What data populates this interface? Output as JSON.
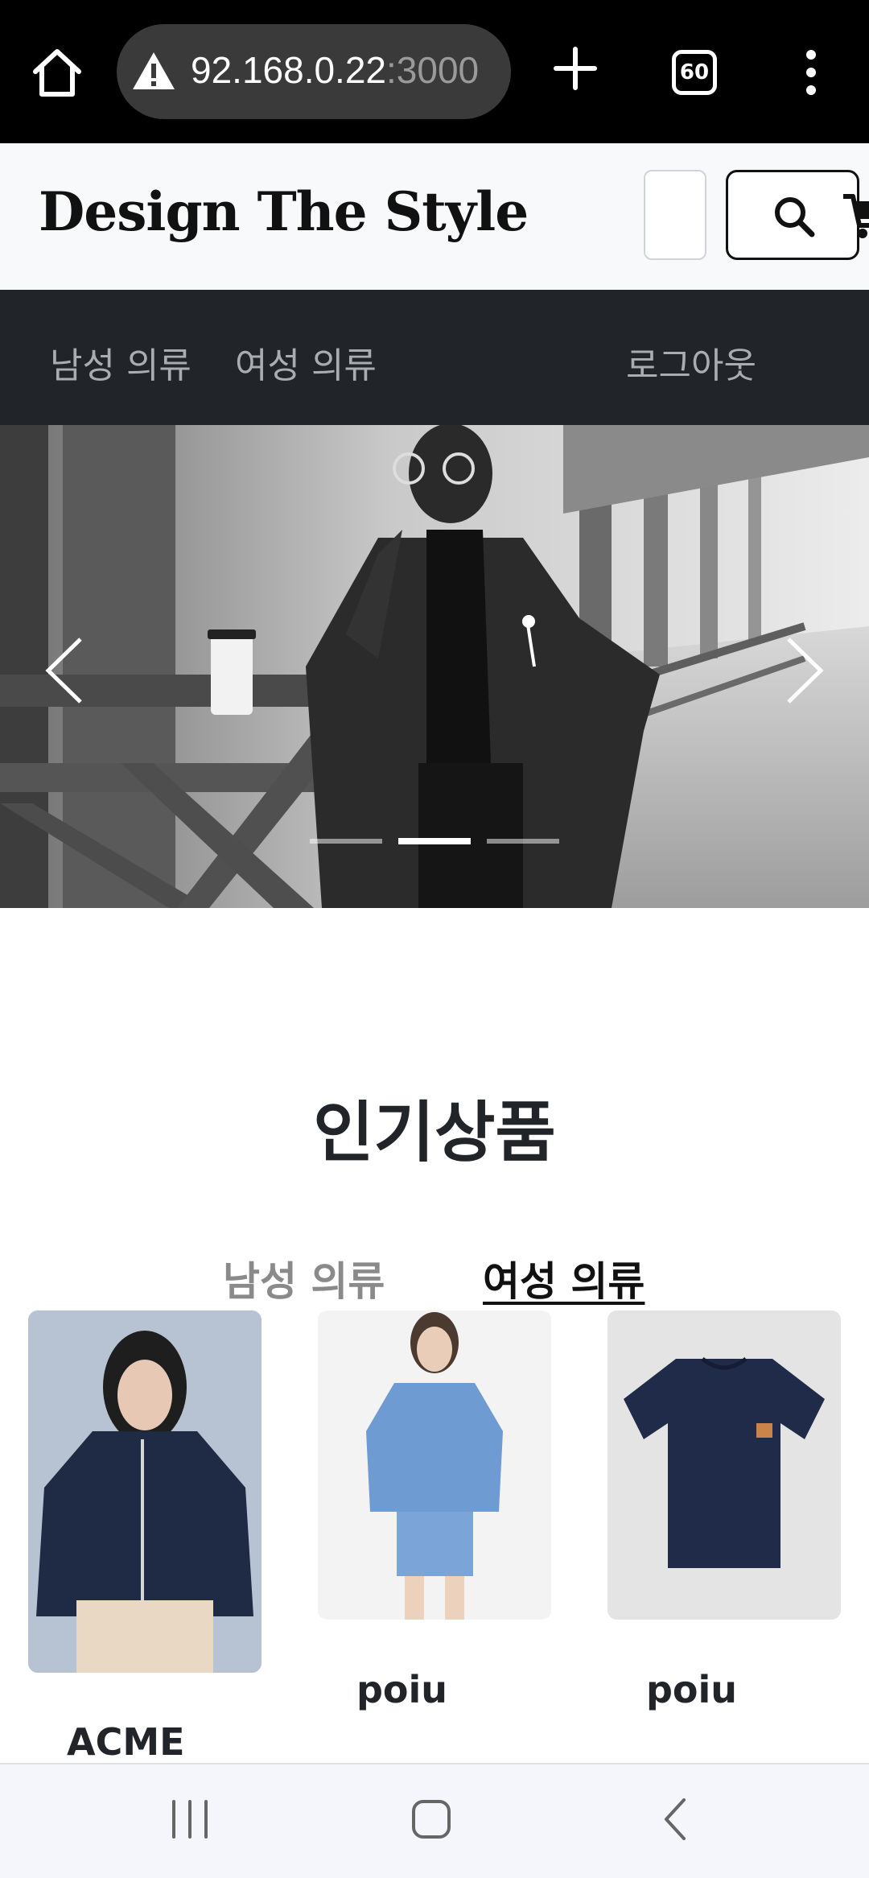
{
  "browser": {
    "url_host": "92.168.0.22",
    "url_port": ":3000",
    "tab_count": "60"
  },
  "header": {
    "brand": "Design The Style"
  },
  "nav": {
    "men_label": "남성 의류",
    "women_label": "여성 의류",
    "logout_label": "로그아웃"
  },
  "carousel": {
    "slide_count": 3,
    "active_index": 1
  },
  "popular": {
    "title": "인기상품",
    "tabs": [
      {
        "label": "남성 의류",
        "active": false
      },
      {
        "label": "여성 의류",
        "active": true
      }
    ],
    "products": [
      {
        "name": "ACME"
      },
      {
        "name": "poiu"
      },
      {
        "name": "poiu"
      }
    ]
  },
  "colors": {
    "navbar_bg": "#212529",
    "header_bg": "#f8f9fa",
    "browser_bg": "#000000"
  }
}
